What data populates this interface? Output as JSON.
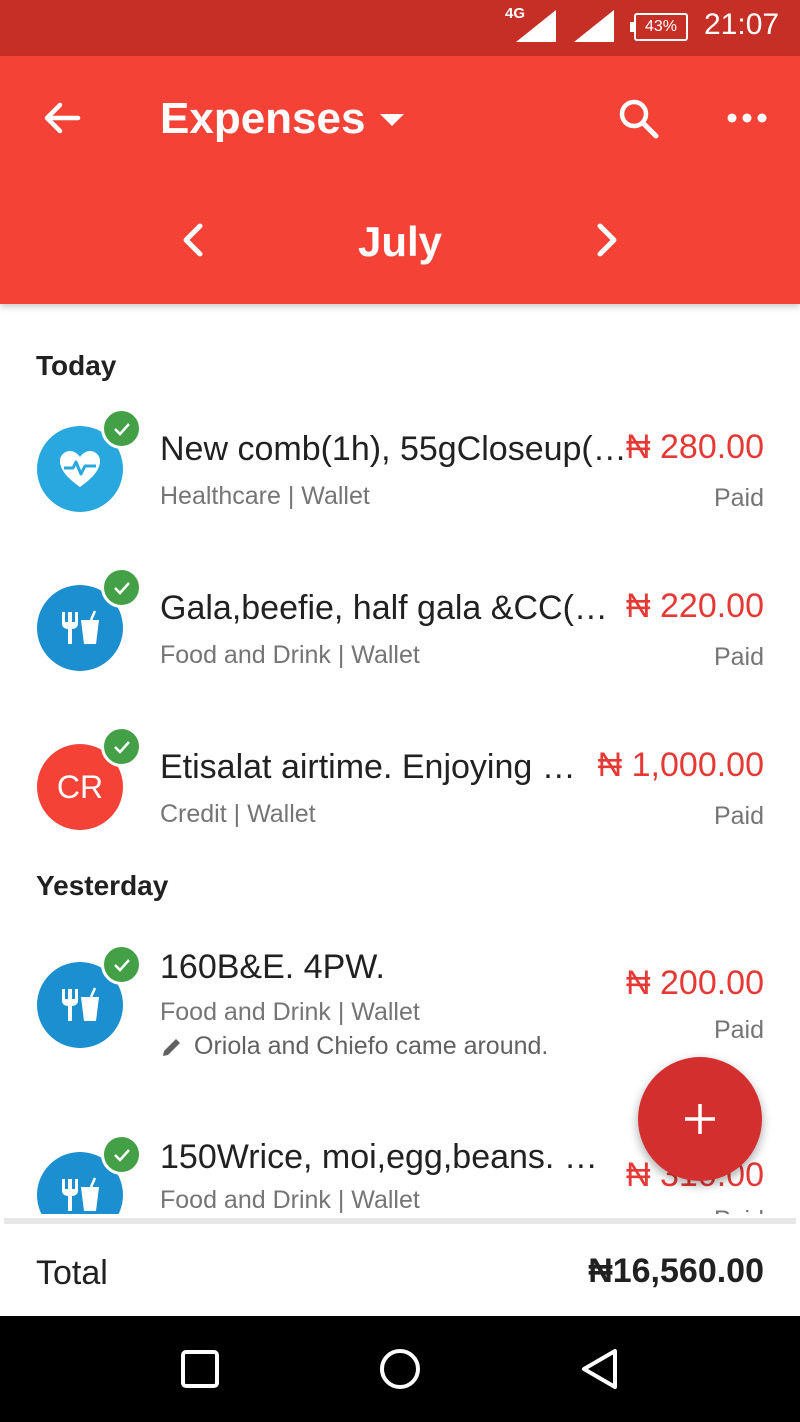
{
  "status_bar": {
    "network": "4G",
    "battery": "43%",
    "time": "21:07"
  },
  "header": {
    "title": "Expenses",
    "month": "July"
  },
  "sections": [
    {
      "label": "Today",
      "items": [
        {
          "title": "New comb(1h), 55gCloseup(…",
          "subtitle": "Healthcare | Wallet",
          "amount": "₦ 280.00",
          "status": "Paid",
          "avatar_icon": "heart-pulse-icon",
          "avatar_color": "#29a8e0"
        },
        {
          "title": "Gala,beefie, half gala &CC(C…",
          "subtitle": "Food and Drink | Wallet",
          "amount": "₦ 220.00",
          "status": "Paid",
          "avatar_icon": "fork-drink-icon",
          "avatar_color": "#1b8fcf"
        },
        {
          "title": "Etisalat airtime. Enjoying t…",
          "subtitle": "Credit | Wallet",
          "amount": "₦ 1,000.00",
          "status": "Paid",
          "avatar_text": "CR",
          "avatar_color": "#f44336"
        }
      ]
    },
    {
      "label": "Yesterday",
      "items": [
        {
          "title": "160B&E. 4PW.",
          "subtitle": "Food and Drink | Wallet",
          "note": "Oriola and Chiefo came around.",
          "amount": "₦ 200.00",
          "status": "Paid",
          "avatar_icon": "fork-drink-icon",
          "avatar_color": "#1b8fcf"
        },
        {
          "title": "150Wrice, moi,egg,beans. 1…",
          "subtitle": "Food and Drink | Wallet",
          "amount": "₦ 310.00",
          "status": "Paid",
          "avatar_icon": "fork-drink-icon",
          "avatar_color": "#1b8fcf"
        }
      ]
    }
  ],
  "total": {
    "label": "Total",
    "amount": "₦16,560.00"
  },
  "colors": {
    "status_bar": "#c62f25",
    "app_bar": "#f44336",
    "fab": "#d32f2f",
    "amount": "#e53935",
    "check": "#43a047"
  }
}
